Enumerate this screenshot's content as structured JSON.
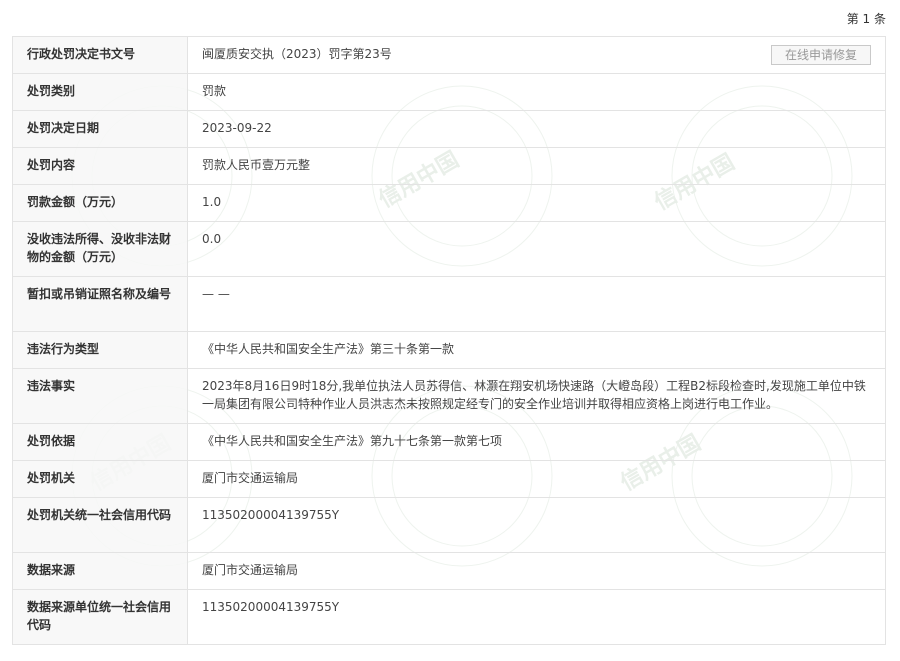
{
  "count_label": "第 1 条",
  "repair_button": "在线申请修复",
  "watermark_text": "信用中国",
  "rows": [
    {
      "label": "行政处罚决定书文号",
      "value": "闽厦质安交执（2023）罚字第23号"
    },
    {
      "label": "处罚类别",
      "value": "罚款"
    },
    {
      "label": "处罚决定日期",
      "value": "2023-09-22"
    },
    {
      "label": "处罚内容",
      "value": "罚款人民币壹万元整"
    },
    {
      "label": "罚款金额（万元）",
      "value": "1.0"
    },
    {
      "label": "没收违法所得、没收非法财物的金额（万元）",
      "value": "0.0"
    },
    {
      "label": "暂扣或吊销证照名称及编号",
      "value": "— —"
    },
    {
      "label": "违法行为类型",
      "value": "《中华人民共和国安全生产法》第三十条第一款"
    },
    {
      "label": "违法事实",
      "value": "2023年8月16日9时18分,我单位执法人员苏得信、林灏在翔安机场快速路（大嶝岛段）工程B2标段检查时,发现施工单位中铁一局集团有限公司特种作业人员洪志杰未按照规定经专门的安全作业培训并取得相应资格上岗进行电工作业。"
    },
    {
      "label": "处罚依据",
      "value": "《中华人民共和国安全生产法》第九十七条第一款第七项"
    },
    {
      "label": "处罚机关",
      "value": "厦门市交通运输局"
    },
    {
      "label": "处罚机关统一社会信用代码",
      "value": "11350200004139755Y"
    },
    {
      "label": "数据来源",
      "value": "厦门市交通运输局"
    },
    {
      "label": "数据来源单位统一社会信用代码",
      "value": "11350200004139755Y"
    }
  ]
}
